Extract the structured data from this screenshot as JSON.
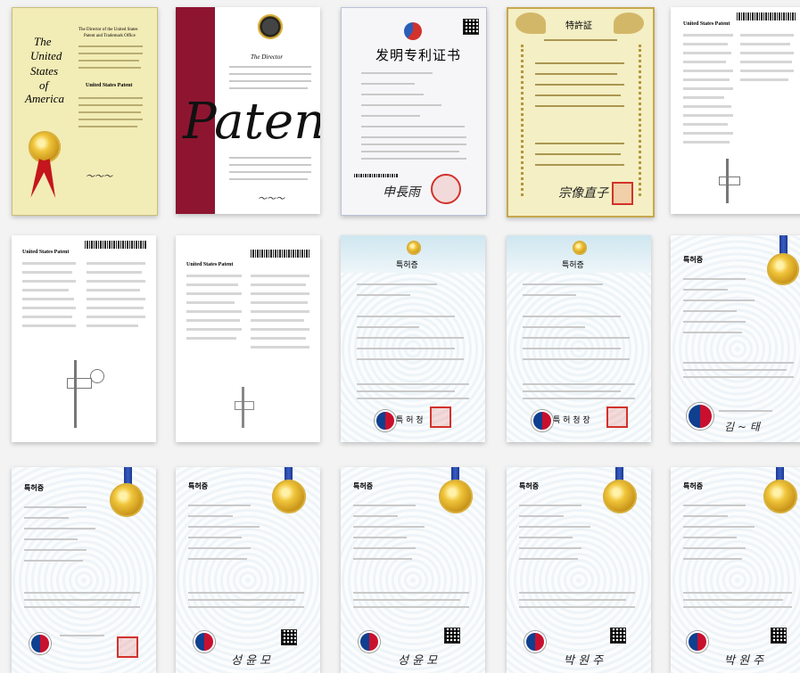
{
  "row1": {
    "us_cert": {
      "logo_line1": "The",
      "logo_line2": "United",
      "logo_line3": "States",
      "logo_line4": "of",
      "logo_line5": "America",
      "header_line1": "The Director of the United States",
      "header_line2": "Patent and Trademark Office",
      "heading": "United States Patent"
    },
    "patent_cert": {
      "big_title": "Patent",
      "heading": "The Director"
    },
    "cn_cert": {
      "title": "发明专利证书"
    },
    "jp_cert": {
      "title": "特許証"
    },
    "us_doc": {
      "heading": "United States Patent"
    }
  },
  "row2": {
    "us_doc_a": {
      "heading": "United States Patent"
    },
    "us_doc_b": {
      "heading": "United States Patent"
    },
    "kr_cert_a": {
      "title": "특허증"
    },
    "kr_cert_b": {
      "title": "특허증"
    },
    "kr_cert_c": {
      "title": "특허증"
    }
  },
  "row3": {
    "kr_cert_1": {
      "title": "특허증"
    },
    "kr_cert_2": {
      "title": "특허증"
    },
    "kr_cert_3": {
      "title": "특허증"
    },
    "kr_cert_4": {
      "title": "특허증"
    },
    "kr_cert_5": {
      "title": "특허증"
    }
  },
  "colors": {
    "gold": "#e0b83a",
    "maroon": "#8e1530",
    "seal_red": "#d2322c",
    "ribbon_blue": "#1b3a8f"
  }
}
